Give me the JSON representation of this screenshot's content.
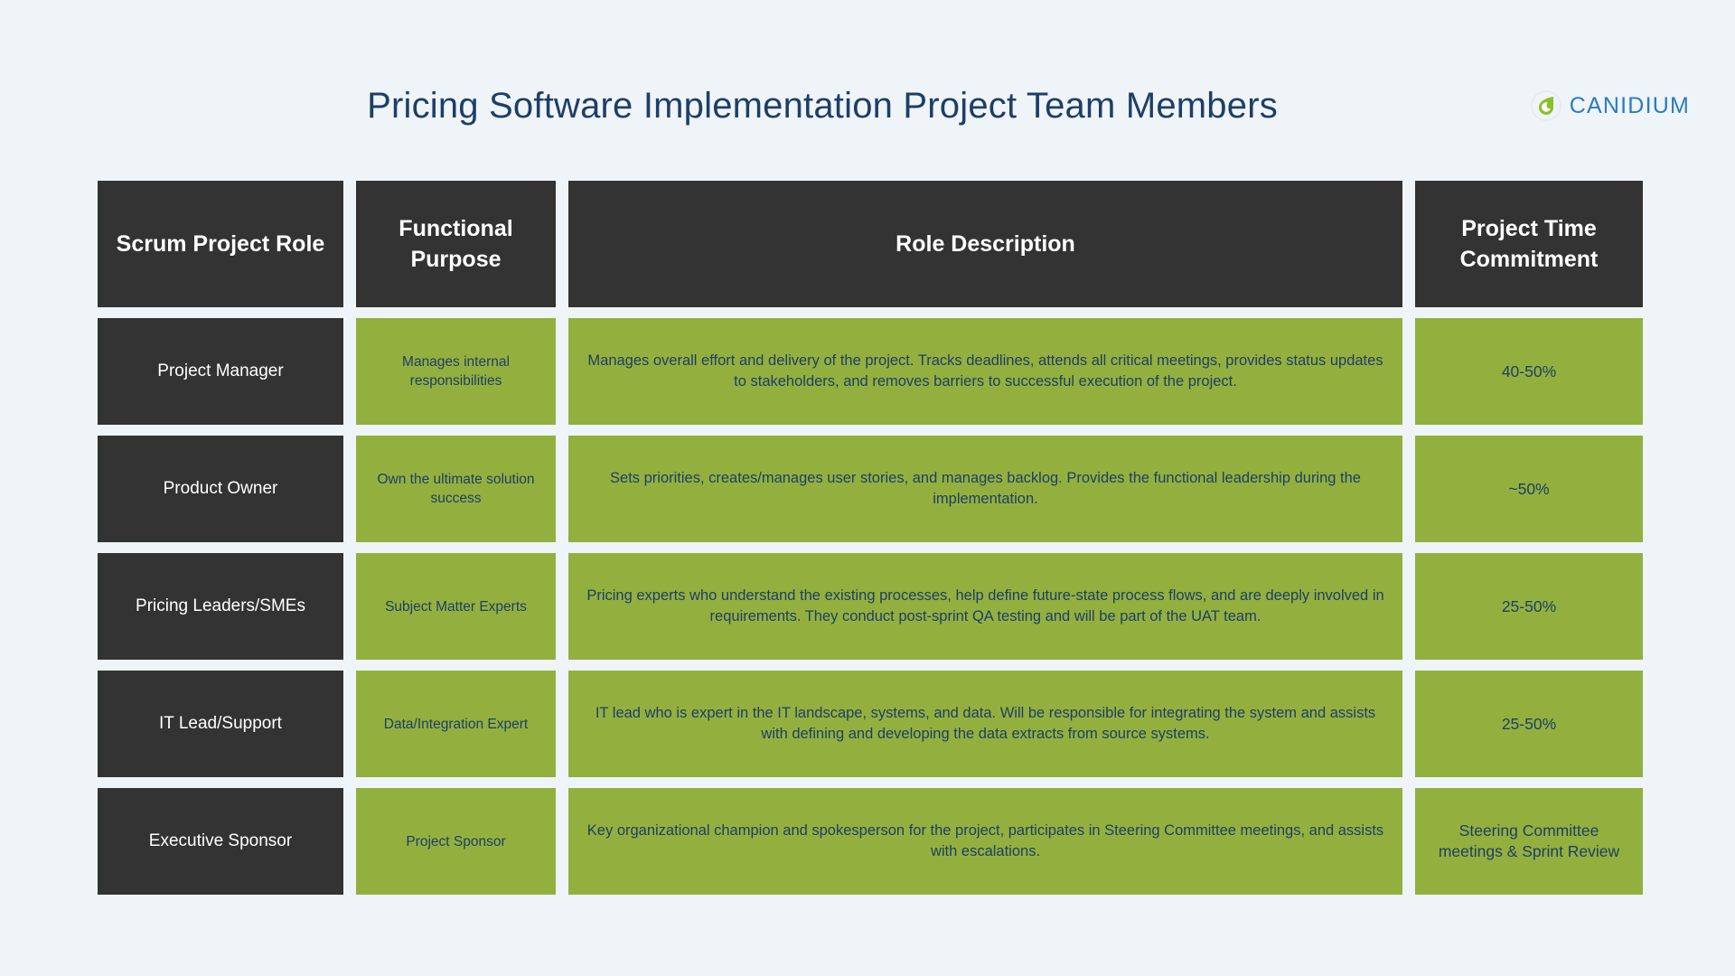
{
  "header": {
    "title": "Pricing Software Implementation Project Team Members",
    "logo": {
      "wordmark": "CANIDIUM",
      "mark_icon": "canidium-droplet-icon",
      "mark_color": "#8cbf2c",
      "wordmark_color": "#2b7cc4"
    }
  },
  "colors": {
    "background": "#eff4f8",
    "header_cell": "#333333",
    "accent_green": "#93b03f",
    "title_text": "#1d3f66",
    "body_text_on_green": "#1d3f66",
    "text_on_dark": "#ffffff"
  },
  "table": {
    "columns": [
      {
        "key": "role",
        "label": "Scrum Project Role"
      },
      {
        "key": "purpose",
        "label": "Functional Purpose"
      },
      {
        "key": "description",
        "label": "Role Description"
      },
      {
        "key": "time",
        "label": "Project Time Commitment"
      }
    ],
    "rows": [
      {
        "role": "Project Manager",
        "purpose": "Manages internal responsibilities",
        "description": "Manages overall effort and delivery of the project. Tracks deadlines, attends all critical meetings, provides status updates to stakeholders, and removes barriers to successful execution of the project.",
        "time": "40-50%"
      },
      {
        "role": "Product Owner",
        "purpose": "Own the ultimate solution success",
        "description": "Sets priorities, creates/manages user stories, and manages backlog. Provides the functional leadership during the implementation.",
        "time": "~50%"
      },
      {
        "role": "Pricing Leaders/SMEs",
        "purpose": "Subject Matter Experts",
        "description": "Pricing experts who understand the existing processes, help define future-state process flows, and are deeply involved in requirements. They conduct post-sprint QA testing and will be part of the UAT team.",
        "time": "25-50%"
      },
      {
        "role": "IT Lead/Support",
        "purpose": "Data/Integration Expert",
        "description": "IT lead who is expert in the IT landscape, systems, and data. Will be responsible for integrating the system and assists with defining and developing the data extracts from source systems.",
        "time": "25-50%"
      },
      {
        "role": "Executive Sponsor",
        "purpose": "Project Sponsor",
        "description": "Key organizational champion and spokesperson for the project, participates in Steering Committee meetings, and assists with escalations.",
        "time": "Steering Committee meetings & Sprint Review"
      }
    ]
  }
}
